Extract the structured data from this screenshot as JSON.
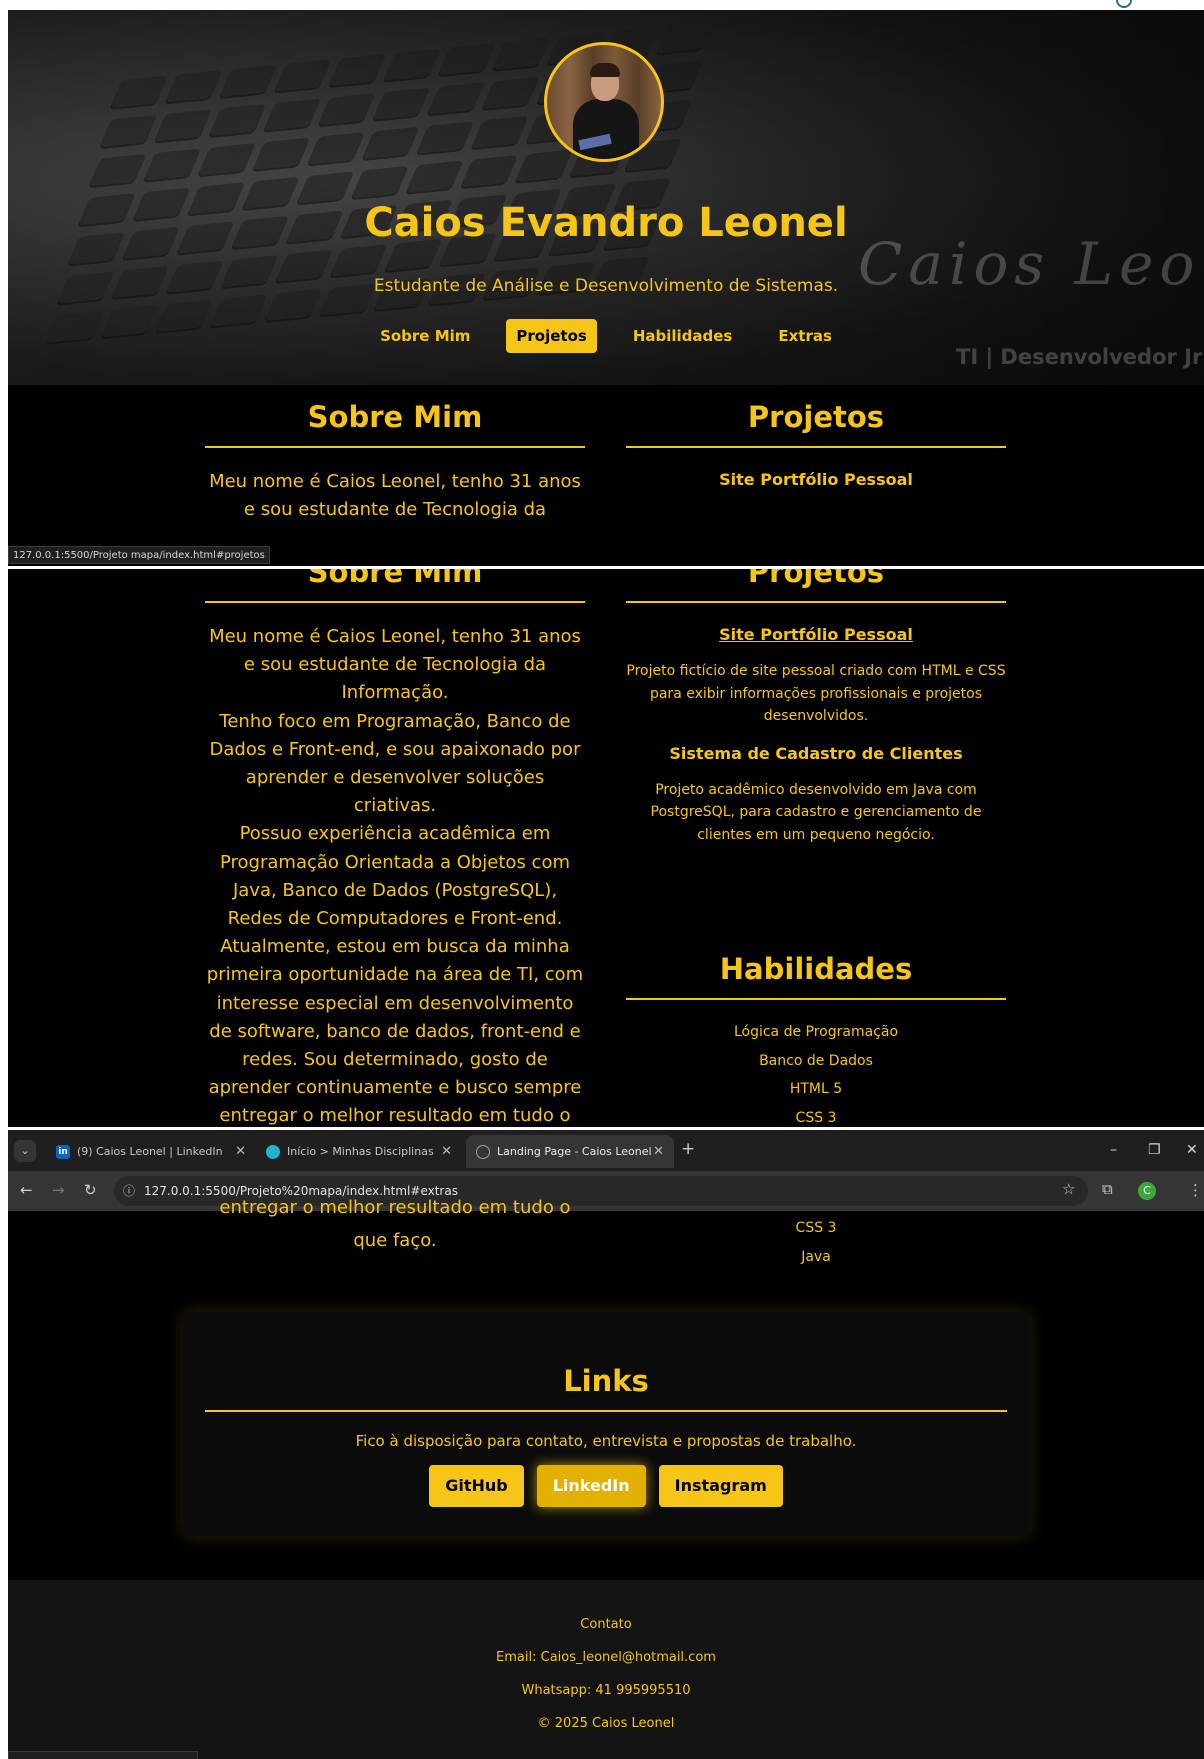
{
  "hero": {
    "name": "Caios Evandro Leonel",
    "subtitle": "Estudante de Análise e Desenvolvimento de Sistemas.",
    "signature": "Caios Leonel",
    "signature_role": "TI | Desenvolvedor Jr",
    "nav": [
      {
        "label": "Sobre Mim",
        "active": false
      },
      {
        "label": "Projetos",
        "active": true
      },
      {
        "label": "Habilidades",
        "active": false
      },
      {
        "label": "Extras",
        "active": false
      }
    ]
  },
  "status_bar": {
    "hover_url": "127.0.0.1:5500/Projeto mapa/index.html#projetos"
  },
  "about": {
    "title": "Sobre Mim",
    "text_preview": "Meu nome é Caios Leonel, tenho 31 anos e sou estudante de Tecnologia da",
    "paragraphs": [
      "Meu nome é Caios Leonel, tenho 31 anos e sou estudante de Tecnologia da Informação.",
      "Tenho foco em Programação, Banco de Dados e Front-end, e sou apaixonado por aprender e desenvolver soluções criativas.",
      "Possuo experiência acadêmica em Programação Orientada a Objetos com Java, Banco de Dados (PostgreSQL), Redes de Computadores e Front-end.",
      "Atualmente, estou em busca da minha primeira oportunidade na área de TI, com interesse especial em desenvolvimento de software, banco de dados, front-end e redes. Sou determinado, gosto de aprender continuamente e busco sempre entregar o melhor resultado em tudo o que faço."
    ],
    "tail_cut": "entregar o melhor resultado em tudo o",
    "tail_end": "que faço."
  },
  "projects": {
    "title": "Projetos",
    "items": [
      {
        "name": "Site Portfólio Pessoal",
        "description": "Projeto fictício de site pessoal criado com HTML e CSS para exibir informações profissionais e projetos desenvolvidos."
      },
      {
        "name": "Sistema de Cadastro de Clientes",
        "description": "Projeto acadêmico desenvolvido em Java com PostgreSQL, para cadastro e gerenciamento de clientes em um pequeno negócio."
      }
    ]
  },
  "skills": {
    "title": "Habilidades",
    "items": [
      "Lógica de Programação",
      "Banco de Dados",
      "HTML 5",
      "CSS 3",
      "Java"
    ]
  },
  "browser": {
    "tabs": [
      {
        "title": "(9) Caios Leonel | LinkedIn",
        "favicon": "linkedin-icon",
        "favicon_color": "#0a66c2",
        "active": false
      },
      {
        "title": "Início > Minhas Disciplinas > D",
        "favicon": "university-icon",
        "favicon_color": "#1fb4c9",
        "active": false
      },
      {
        "title": "Landing Page - Caios Leonel",
        "favicon": "globe-icon",
        "favicon_color": "#9aa0a6",
        "active": true
      }
    ],
    "url": "127.0.0.1:5500/Projeto%20mapa/index.html#extras",
    "profile_initial": "C",
    "profile_color": "#3aa83a"
  },
  "links": {
    "title": "Links",
    "text": "Fico à disposição para contato, entrevista e propostas de trabalho.",
    "buttons": [
      {
        "label": "GitHub",
        "active": false
      },
      {
        "label": "LinkedIn",
        "active": true
      },
      {
        "label": "Instagram",
        "active": false
      }
    ]
  },
  "footer": {
    "heading": "Contato",
    "email": "Email: Caios_leonel@hotmail.com",
    "whatsapp": "Whatsapp: 41 995995510",
    "copyright": "© 2025 Caios Leonel"
  },
  "colors": {
    "accent": "#f5c518",
    "background": "#000000",
    "footer": "#141414"
  }
}
